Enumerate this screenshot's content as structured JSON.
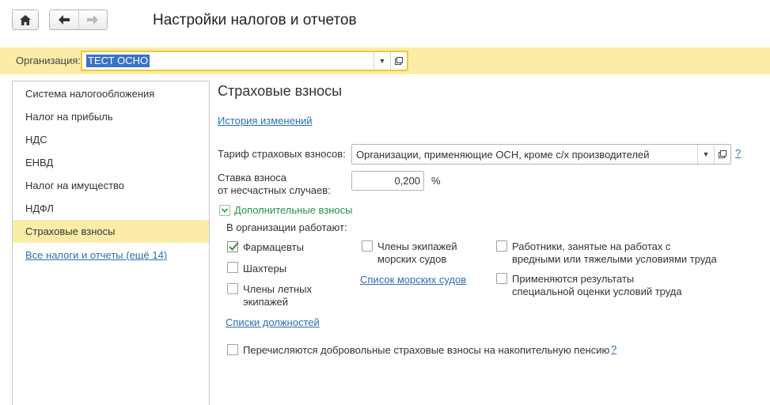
{
  "toolbar": {
    "title": "Настройки налогов и отчетов"
  },
  "org": {
    "label": "Организация:",
    "value": "ТЕСТ ОСНО"
  },
  "sidebar": {
    "items": [
      {
        "label": "Система налогообложения"
      },
      {
        "label": "Налог на прибыль"
      },
      {
        "label": "НДС"
      },
      {
        "label": "ЕНВД"
      },
      {
        "label": "Налог на имущество"
      },
      {
        "label": "НДФЛ"
      },
      {
        "label": "Страховые взносы"
      }
    ],
    "all_link": "Все налоги и отчеты (ещё 14)"
  },
  "main": {
    "title": "Страховые взносы",
    "history_link": "История изменений",
    "tariff": {
      "label": "Тариф страховых взносов:",
      "value": "Организации, применяющие ОСН, кроме с/х производителей",
      "help": "?"
    },
    "accident_rate": {
      "label_line1": "Ставка взноса",
      "label_line2": "от несчастных случаев:",
      "value": "0,200",
      "unit": "%"
    },
    "additional": {
      "label": "Дополнительные взносы",
      "works_label": "В организации работают:",
      "pharmacists": {
        "line1": "Фармацевты",
        "checked": true
      },
      "miners": {
        "line1": "Шахтеры",
        "checked": false
      },
      "flight_crews": {
        "line1": "Члены летных",
        "line2": "экипажей",
        "checked": false
      },
      "sea_crews": {
        "line1": "Члены экипажей",
        "line2": "морских судов",
        "checked": false
      },
      "hazardous": {
        "line1": "Работники, занятые на работах с",
        "line2": "вредными или тяжелыми условиями труда",
        "checked": false
      },
      "special_eval": {
        "line1": "Применяются результаты",
        "line2": "специальной оценки условий труда",
        "checked": false
      },
      "positions_link": "Списки должностей",
      "ships_link": "Список морских судов",
      "voluntary": {
        "line1": "Перечисляются добровольные страховые взносы на накопительную пенсию",
        "checked": false
      },
      "voluntary_help": "?"
    }
  }
}
